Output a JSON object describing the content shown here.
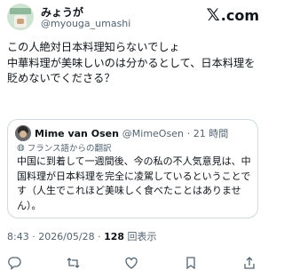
{
  "header": {
    "display_name": "みょうが",
    "handle": "@myouga_umashi",
    "logo_text": ".com",
    "logo_icon": "x-icon"
  },
  "tweet": {
    "text": "この人絶対日本料理知らないでしょ\n中華料理が美味しいのは分かるとして、日本料理を\n貶めないでくださる？"
  },
  "quote": {
    "name": "Mime van Osen",
    "handle": "@MimeOsen",
    "time": "· 21 時間",
    "translated_label": "フランス語からの翻訳",
    "text": "中国に到着して一週間後、今の私の不人気意見は、中\n国料理が日本料理を完全に凌駕しているということで\nす（人生でこれほど美味しく食べたことはありませ\nん）。"
  },
  "meta": {
    "timestamp": "8:43 · 2026/05/28 · ",
    "views_count": "128",
    "views_label": " 回表示"
  },
  "actions": [
    {
      "name": "reply-icon",
      "glyph": "◯"
    },
    {
      "name": "retweet-icon",
      "glyph": "⇄"
    },
    {
      "name": "like-icon",
      "glyph": "♡"
    },
    {
      "name": "bookmark-icon",
      "glyph": "⌑"
    },
    {
      "name": "share-icon",
      "glyph": "⇪"
    }
  ],
  "colors": {
    "text": "#0f1419",
    "secondary": "#536471",
    "border": "#cfd9de"
  }
}
